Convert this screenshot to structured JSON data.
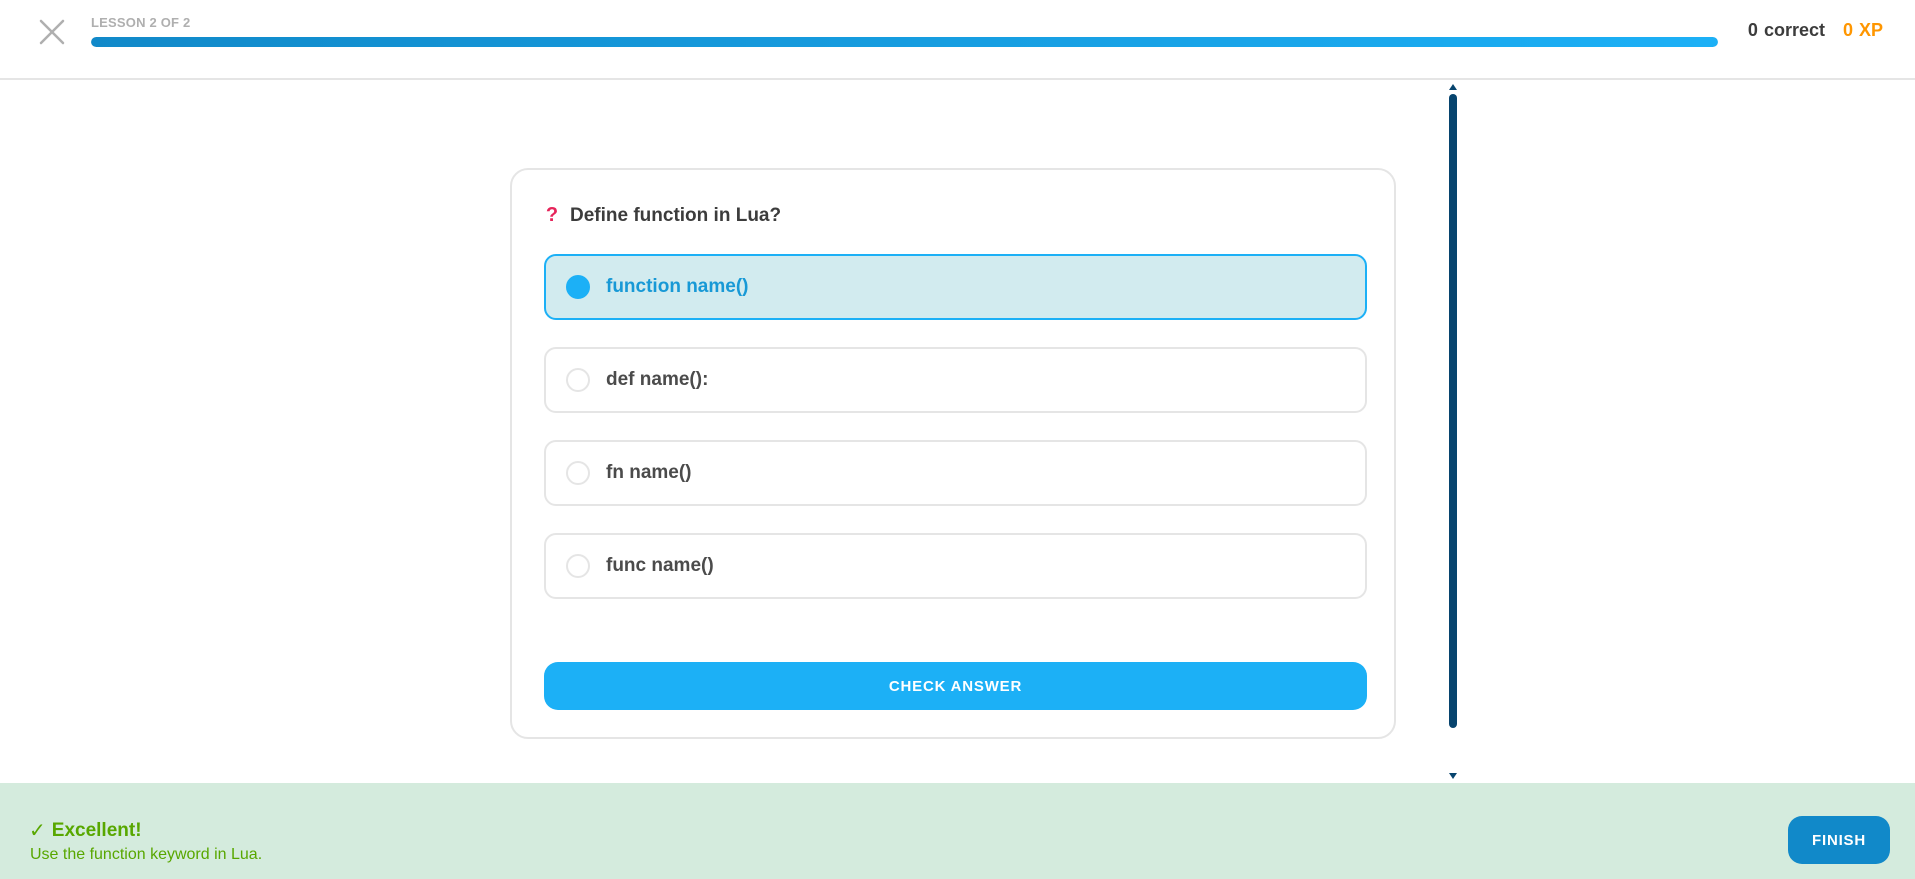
{
  "header": {
    "lesson_label": "LESSON 2 OF 2",
    "progress_fraction": 1.0,
    "correct_count": "0",
    "correct_label": "correct",
    "xp_count": "0",
    "xp_label": "XP"
  },
  "question": {
    "icon": "question-mark-icon",
    "icon_glyph": "❓",
    "text": "Define function in Lua?"
  },
  "options": [
    {
      "label": "function name()",
      "selected": true
    },
    {
      "label": "def name():",
      "selected": false
    },
    {
      "label": "fn name()",
      "selected": false
    },
    {
      "label": "func name()",
      "selected": false
    }
  ],
  "check_button": {
    "label": "CHECK ANSWER"
  },
  "feedback": {
    "status_icon": "check-icon",
    "status_glyph": "✓",
    "title": "Excellent!",
    "message": "Use the function keyword in Lua."
  },
  "finish_button": {
    "label": "FINISH"
  },
  "colors": {
    "accent": "#1cb0f6",
    "accent_dark": "#1189c9",
    "success": "#58a700",
    "success_bg": "#d4ebdd",
    "xp": "#ff9600",
    "question_icon": "#e6245a",
    "scrollbar": "#07446e"
  }
}
